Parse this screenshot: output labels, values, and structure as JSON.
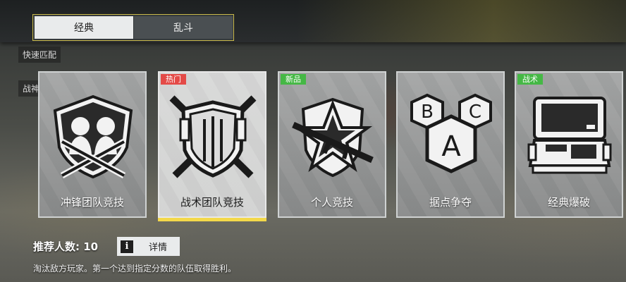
{
  "tabs": [
    {
      "label": "经典",
      "active": true
    },
    {
      "label": "乱斗",
      "active": false
    }
  ],
  "background_labels": {
    "quick_match": "快速匹配",
    "ranked": "战神排位"
  },
  "modes": [
    {
      "label": "冲锋团队竞技",
      "badge": "",
      "icon": "team-deathmatch-icon",
      "selected": false
    },
    {
      "label": "战术团队竞技",
      "badge": "热门",
      "badge_color": "#e44a47",
      "icon": "tactical-shield-icon",
      "selected": true
    },
    {
      "label": "个人竞技",
      "badge": "新品",
      "badge_color": "#45b845",
      "icon": "star-rifle-icon",
      "selected": false
    },
    {
      "label": "据点争夺",
      "badge": "",
      "icon": "abc-hexagon-icon",
      "selected": false
    },
    {
      "label": "经典爆破",
      "badge": "战术",
      "badge_color": "#45b845",
      "icon": "bomb-case-icon",
      "selected": false
    }
  ],
  "footer": {
    "recommended": "推荐人数: 10",
    "details_label": "详情",
    "info_glyph": "i",
    "description": "淘汰敌方玩家。第一个达到指定分数的队伍取得胜利。"
  },
  "colors": {
    "accent_yellow": "#f3d84a",
    "badge_red": "#e44a47",
    "badge_green": "#45b845"
  }
}
